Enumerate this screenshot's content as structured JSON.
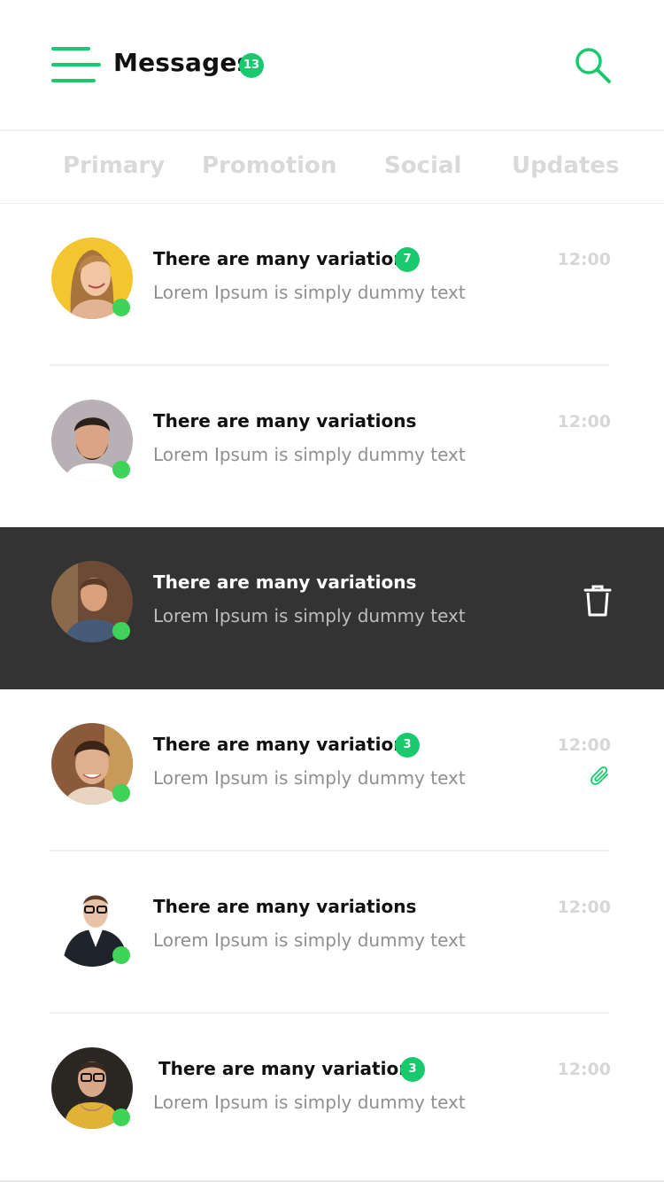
{
  "header": {
    "title": "Messages",
    "badge": "13",
    "menu_icon": "hamburger-menu-icon",
    "search_icon": "search-icon",
    "accent_color": "#19c96e"
  },
  "tabs": [
    {
      "label": "Primary"
    },
    {
      "label": "Promotion"
    },
    {
      "label": "Social"
    },
    {
      "label": "Updates"
    }
  ],
  "messages": [
    {
      "title": "There are many variations",
      "preview": "Lorem Ipsum is simply dummy text",
      "time": "12:00",
      "badge": "7",
      "online": true
    },
    {
      "title": "There are many variations",
      "preview": "Lorem Ipsum is simply dummy text",
      "time": "12:00",
      "badge": "",
      "online": true
    },
    {
      "title": "There are many variations",
      "preview": "Lorem Ipsum is simply dummy text",
      "time": "",
      "badge": "",
      "online": true,
      "swiped": true,
      "action_icon": "trash-icon"
    },
    {
      "title": "There are many variations",
      "preview": "Lorem Ipsum is simply dummy text",
      "time": "12:00",
      "badge": "3",
      "online": true,
      "attachment_icon": "paperclip-icon"
    },
    {
      "title": "There are many variations",
      "preview": "Lorem Ipsum is simply dummy text",
      "time": "12:00",
      "badge": "",
      "online": true
    },
    {
      "title": "There are many variations",
      "preview": "Lorem Ipsum is simply dummy text",
      "time": "12:00",
      "badge": "3",
      "online": true
    }
  ],
  "colors": {
    "online": "#3fd35a",
    "swiped_row": "#333333",
    "muted_text": "#8f8f8f",
    "tab_inactive": "#d9d9d9"
  }
}
